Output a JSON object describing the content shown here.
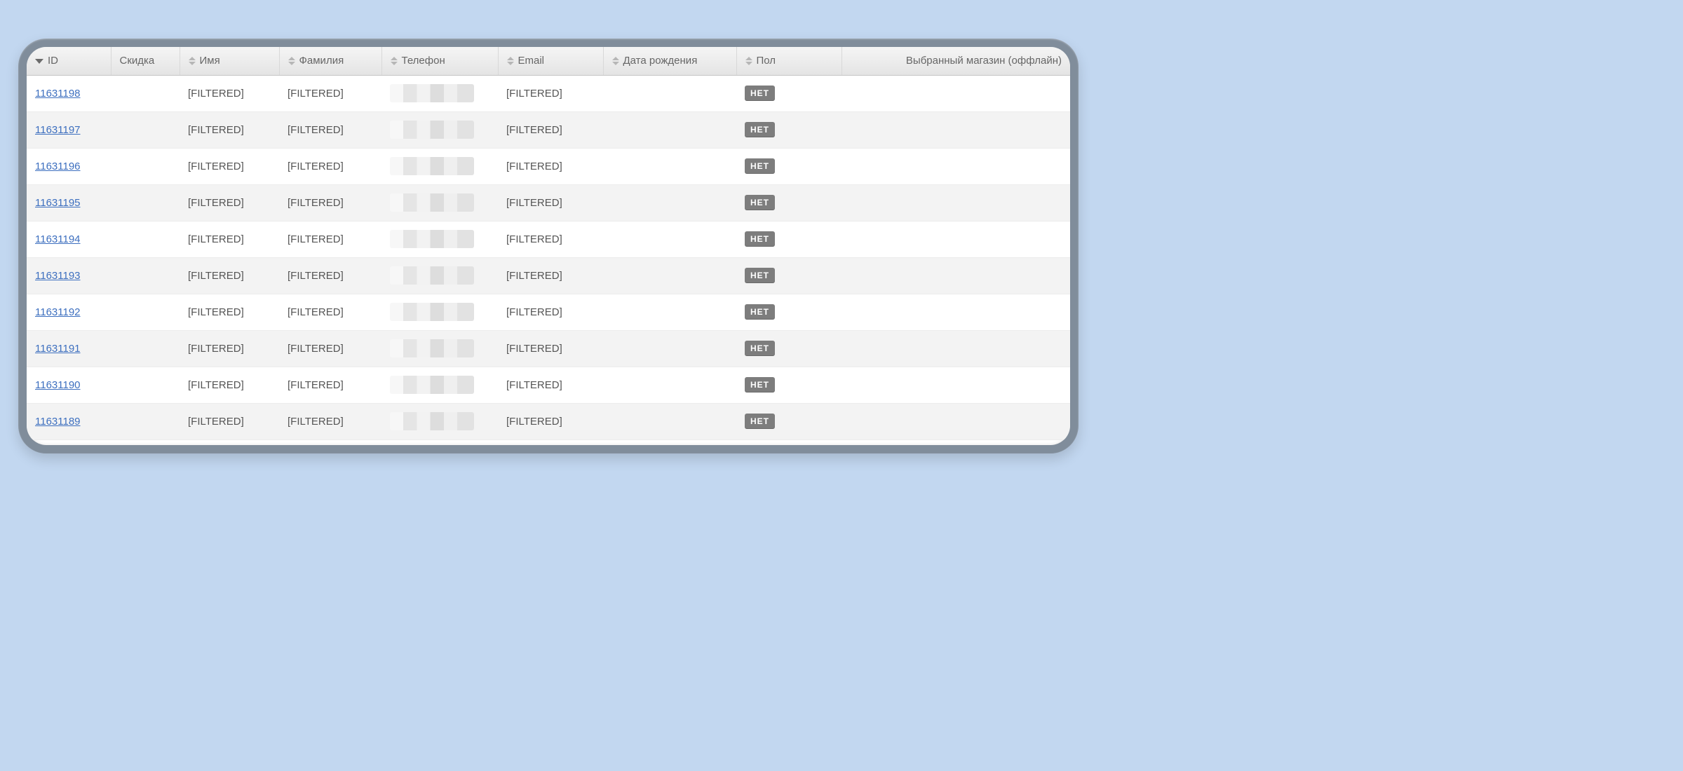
{
  "columns": {
    "id": {
      "label": "ID"
    },
    "skidka": {
      "label": "Скидка"
    },
    "name": {
      "label": "Имя"
    },
    "surname": {
      "label": "Фамилия"
    },
    "phone": {
      "label": "Телефон"
    },
    "email": {
      "label": "Email"
    },
    "dob": {
      "label": "Дата рождения"
    },
    "gender": {
      "label": "Пол"
    },
    "store": {
      "label": "Выбранный магазин (оффлайн)"
    }
  },
  "gender_badge_none": "НЕТ",
  "rows": [
    {
      "id": "11631198",
      "name": "[FILTERED]",
      "surname": "[FILTERED]",
      "email": "[FILTERED]"
    },
    {
      "id": "11631197",
      "name": "[FILTERED]",
      "surname": "[FILTERED]",
      "email": "[FILTERED]"
    },
    {
      "id": "11631196",
      "name": "[FILTERED]",
      "surname": "[FILTERED]",
      "email": "[FILTERED]"
    },
    {
      "id": "11631195",
      "name": "[FILTERED]",
      "surname": "[FILTERED]",
      "email": "[FILTERED]"
    },
    {
      "id": "11631194",
      "name": "[FILTERED]",
      "surname": "[FILTERED]",
      "email": "[FILTERED]"
    },
    {
      "id": "11631193",
      "name": "[FILTERED]",
      "surname": "[FILTERED]",
      "email": "[FILTERED]"
    },
    {
      "id": "11631192",
      "name": "[FILTERED]",
      "surname": "[FILTERED]",
      "email": "[FILTERED]"
    },
    {
      "id": "11631191",
      "name": "[FILTERED]",
      "surname": "[FILTERED]",
      "email": "[FILTERED]"
    },
    {
      "id": "11631190",
      "name": "[FILTERED]",
      "surname": "[FILTERED]",
      "email": "[FILTERED]"
    },
    {
      "id": "11631189",
      "name": "[FILTERED]",
      "surname": "[FILTERED]",
      "email": "[FILTERED]"
    }
  ]
}
